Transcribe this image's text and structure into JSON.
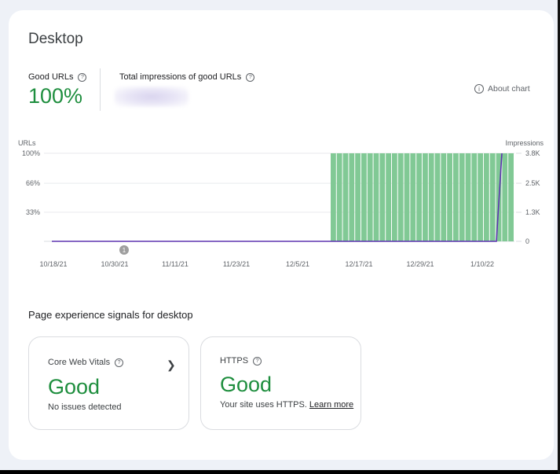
{
  "page_title": "Desktop",
  "metrics": {
    "good_urls_label": "Good URLs",
    "good_urls_value": "100%",
    "impressions_label": "Total impressions of good URLs"
  },
  "about_chart": "About chart",
  "chart_data": {
    "type": "bar",
    "left_axis_label": "URLs",
    "right_axis_label": "Impressions",
    "left_ticks": [
      "100%",
      "66%",
      "33%"
    ],
    "right_ticks": [
      "3.8K",
      "2.5K",
      "1.3K",
      "0"
    ],
    "x_labels": [
      "10/18/21",
      "10/30/21",
      "11/11/21",
      "11/23/21",
      "12/5/21",
      "12/17/21",
      "12/29/21",
      "1/10/22"
    ],
    "bar_series": {
      "name": "Good URLs (%)",
      "bar_count": 30,
      "value": 100
    },
    "line_series": {
      "name": "Impressions",
      "flat_value": 0,
      "final_value": 3800
    },
    "annotation": "1",
    "ylim_left": [
      0,
      100
    ],
    "ylim_right": [
      0,
      3800
    ],
    "colors": {
      "bars": "#81c995",
      "line": "#5e35b1"
    }
  },
  "signals": {
    "section_title": "Page experience signals for desktop",
    "core_web_vitals": {
      "name": "Core Web Vitals",
      "status": "Good",
      "description": "No issues detected"
    },
    "https": {
      "name": "HTTPS",
      "status": "Good",
      "description": "Your site uses HTTPS.",
      "link": "Learn more"
    }
  },
  "colors": {
    "good": "#1e8e3e",
    "accent_bar": "#81c995"
  },
  "icons": [
    "help-icon",
    "info-icon",
    "chevron-right-icon"
  ]
}
